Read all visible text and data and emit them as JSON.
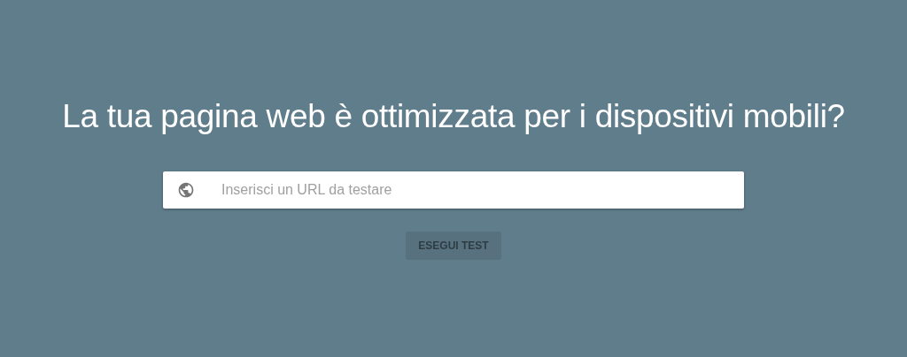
{
  "heading": "La tua pagina web è ottimizzata per i dispositivi mobili?",
  "url_field": {
    "placeholder": "Inserisci un URL da testare"
  },
  "run_button": {
    "label": "ESEGUI TEST",
    "disabled": true
  }
}
